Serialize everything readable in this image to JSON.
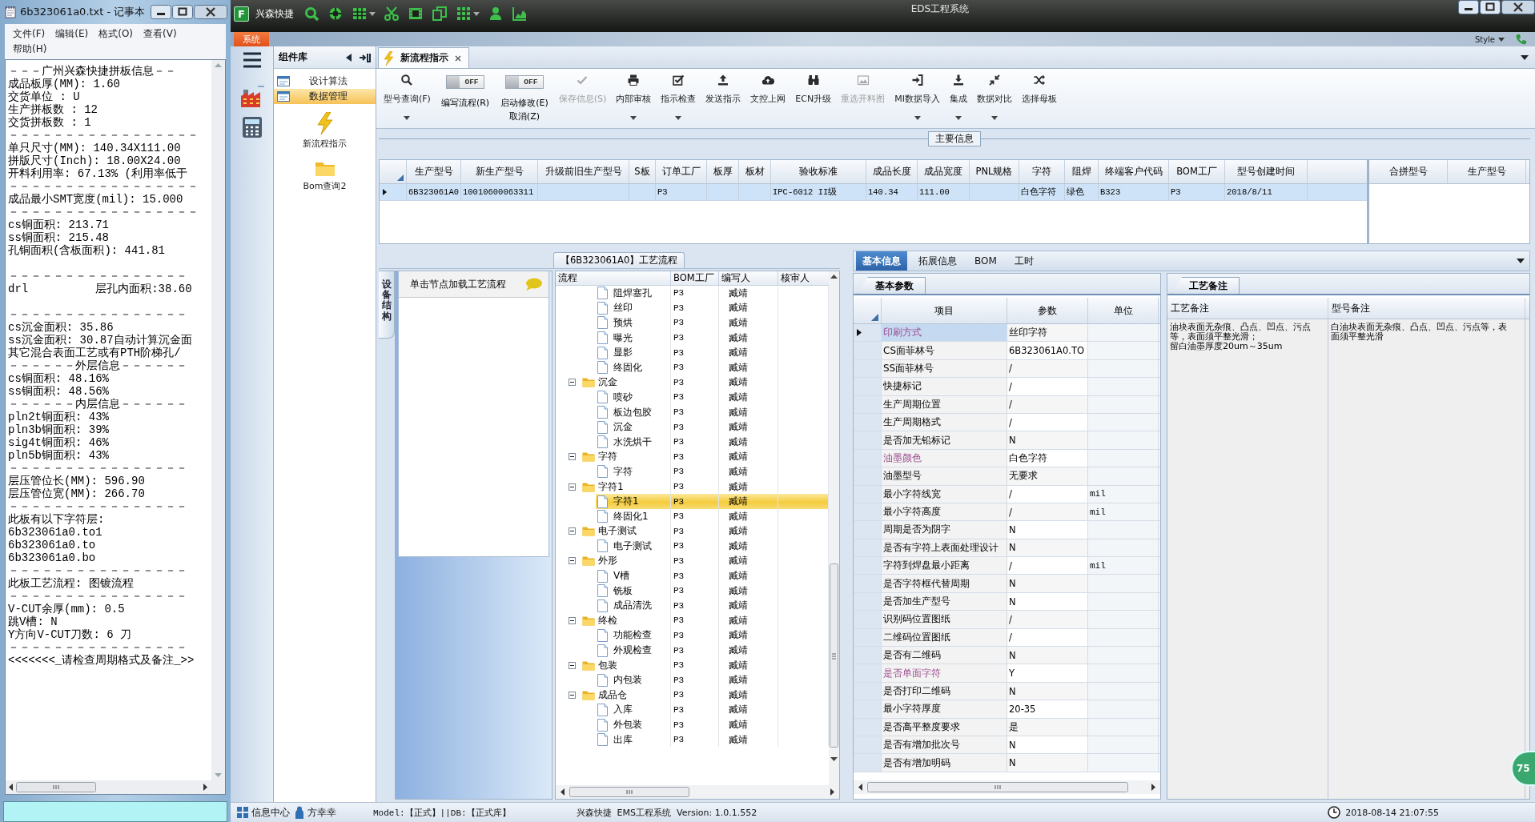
{
  "notepad": {
    "title": "6b323061a0.txt - 记事本",
    "menu": [
      "文件(F)",
      "编辑(E)",
      "格式(O)",
      "查看(V)",
      "帮助(H)"
    ],
    "blocks": [
      [
        "－－－广州兴森快捷拼板信息－－",
        "成品板厚(MM): 1.60",
        "交货单位 : U",
        "生产拼板数 : 12",
        "交货拼板数 : 1",
        "－－－－－－－－－－－－－－－－－",
        "单只尺寸(MM): 140.34X111.00",
        "拼版尺寸(Inch): 18.00X24.00",
        "开料利用率: 67.13% (利用率低于",
        "－－－－－－－－－－－－－－－－－",
        "成品最小SMT宽度(mil): 15.000",
        "－－－－－－－－－－－－－－－－－",
        "cs铜面积: 213.71",
        "ss铜面积: 215.48",
        "孔铜面积(含板面积): 441.81"
      ],
      [
        "－－－－－－－－－－－－－－－－",
        "drl          层孔内面积:38.60"
      ],
      [
        "－－－－－－－－－－－－－－－－",
        "cs沉金面积: 35.86",
        "ss沉金面积: 30.87自动计算沉金面",
        "其它混合表面工艺或有PTH阶梯孔/",
        "－－－－－－外层信息－－－－－－",
        "cs铜面积: 48.16%",
        "ss铜面积: 48.56%",
        "－－－－－－内层信息－－－－－－",
        "pln2t铜面积: 43%",
        "pln3b铜面积: 39%",
        "sig4t铜面积: 46%",
        "pln5b铜面积: 43%",
        "－－－－－－－－－－－－－－－－",
        "层压管位长(MM): 596.90",
        "层压管位宽(MM): 266.70",
        "－－－－－－－－－－－－－－－－",
        "此板有以下字符层:",
        "6b323061a0.to1",
        "6b323061a0.to",
        "6b323061a0.bo",
        "－－－－－－－－－－－－－－－－",
        "此板工艺流程: 图镀流程",
        "－－－－－－－－－－－－－－－－",
        "V-CUT余厚(mm): 0.5",
        "跳V槽: N",
        "Y方向V-CUT刀数: 6 刀",
        "－－－－－－－－－－－－－－－－",
        "<<<<<<<_请检查周期格式及备注_>>"
      ]
    ]
  },
  "app": {
    "logo": "F",
    "brand": "兴森快捷",
    "title": "EDS工程系统",
    "system_tab": "系统",
    "style_menu": "Style"
  },
  "sidebar": {
    "title": "组件库",
    "groups": [
      {
        "label": "设计算法",
        "selected": false
      },
      {
        "label": "数据管理",
        "selected": true
      }
    ],
    "tools": [
      {
        "label": "新流程指示",
        "kind": "lightning"
      },
      {
        "label": "Bom查询2",
        "kind": "folder"
      }
    ]
  },
  "document_tab": {
    "label": "新流程指示"
  },
  "toolbar": [
    {
      "kind": "button",
      "label": "型号查询(F)",
      "menu": true,
      "disabled": false
    },
    {
      "kind": "toggle",
      "label": "编写流程(R)",
      "state": "OFF",
      "on": false
    },
    {
      "kind": "toggle",
      "label": "启动修改(E)",
      "note": "取消(Z)",
      "state": "OFF",
      "on": false
    },
    {
      "kind": "button",
      "label": "保存信息(S)",
      "menu": false,
      "disabled": true
    },
    {
      "kind": "button",
      "label": "内部审核",
      "menu": true,
      "disabled": false
    },
    {
      "kind": "button",
      "label": "指示检查",
      "menu": true,
      "disabled": false
    },
    {
      "kind": "button",
      "label": "发送指示",
      "menu": false,
      "disabled": false
    },
    {
      "kind": "button",
      "label": "文控上网",
      "menu": false,
      "disabled": false
    },
    {
      "kind": "button",
      "label": "ECN升级",
      "menu": false,
      "disabled": false
    },
    {
      "kind": "button",
      "label": "重选开料图",
      "menu": false,
      "disabled": true
    },
    {
      "kind": "button",
      "label": "MI数据导入",
      "menu": true,
      "disabled": false
    },
    {
      "kind": "button",
      "label": "集成",
      "menu": true,
      "disabled": false
    },
    {
      "kind": "button",
      "label": "数据对比",
      "menu": true,
      "disabled": false
    },
    {
      "kind": "button",
      "label": "选择母板",
      "menu": false,
      "disabled": false
    }
  ],
  "main_info": {
    "title": "主要信息",
    "columns": [
      "生产型号",
      "新生产型号",
      "升级前旧生产型号",
      "S板",
      "订单工厂",
      "板厚",
      "板材",
      "验收标准",
      "成品长度",
      "成品宽度",
      "PNL规格",
      "字符",
      "阻焊",
      "终端客户代码",
      "BOM工厂",
      "型号创建时间"
    ],
    "rows": [
      {
        "selected": true,
        "cells": [
          "6B323061A0",
          "10010600063311",
          null,
          null,
          "P3",
          null,
          null,
          "IPC-6012 II级",
          "140.34",
          "111.00",
          null,
          "白色字符",
          "绿色",
          "B323",
          "P3",
          "2018/8/11"
        ]
      }
    ],
    "side_columns": [
      "合拼型号",
      "生产型号"
    ]
  },
  "flow": {
    "title": "【6B323061A0】工艺流程",
    "side_tab": "设备结构",
    "hint": "单击节点加载工艺流程",
    "columns": [
      "流程",
      "BOM工厂",
      "编写人",
      "核审人"
    ],
    "tree": [
      {
        "children": [
          {
            "label": "阻焊塞孔",
            "factory": "P3",
            "author": "臧靖",
            "selected": false
          },
          {
            "label": "丝印",
            "factory": "P3",
            "author": "臧靖",
            "selected": false
          },
          {
            "label": "预烘",
            "factory": "P3",
            "author": "臧靖",
            "selected": false
          },
          {
            "label": "曝光",
            "factory": "P3",
            "author": "臧靖",
            "selected": false
          },
          {
            "label": "显影",
            "factory": "P3",
            "author": "臧靖",
            "selected": false
          },
          {
            "label": "终固化",
            "factory": "P3",
            "author": "臧靖",
            "selected": false
          }
        ]
      },
      {
        "label": "沉金",
        "factory": "P3",
        "author": "臧靖",
        "selected": false,
        "expanded": true,
        "children": [
          {
            "label": "喷砂",
            "factory": "P3",
            "author": "臧靖",
            "selected": false
          },
          {
            "label": "板边包胶",
            "factory": "P3",
            "author": "臧靖",
            "selected": false
          },
          {
            "label": "沉金",
            "factory": "P3",
            "author": "臧靖",
            "selected": false
          },
          {
            "label": "水洗烘干",
            "factory": "P3",
            "author": "臧靖",
            "selected": false
          }
        ]
      },
      {
        "label": "字符",
        "factory": "P3",
        "author": "臧靖",
        "selected": false,
        "expanded": true,
        "children": [
          {
            "label": "字符",
            "factory": "P3",
            "author": "臧靖",
            "selected": false
          }
        ]
      },
      {
        "label": "字符1",
        "factory": "P3",
        "author": "臧靖",
        "selected": false,
        "expanded": true,
        "children": [
          {
            "label": "字符1",
            "factory": "P3",
            "author": "臧靖",
            "selected": true
          },
          {
            "label": "终固化1",
            "factory": "P3",
            "author": "臧靖",
            "selected": false
          }
        ]
      },
      {
        "label": "电子测试",
        "factory": "P3",
        "author": "臧靖",
        "selected": false,
        "expanded": true,
        "children": [
          {
            "label": "电子测试",
            "factory": "P3",
            "author": "臧靖",
            "selected": false
          }
        ]
      },
      {
        "label": "外形",
        "factory": "P3",
        "author": "臧靖",
        "selected": false,
        "expanded": true,
        "children": [
          {
            "label": "V槽",
            "factory": "P3",
            "author": "臧靖",
            "selected": false
          },
          {
            "label": "铣板",
            "factory": "P3",
            "author": "臧靖",
            "selected": false
          },
          {
            "label": "成品清洗",
            "factory": "P3",
            "author": "臧靖",
            "selected": false
          }
        ]
      },
      {
        "label": "终检",
        "factory": "P3",
        "author": "臧靖",
        "selected": false,
        "expanded": true,
        "children": [
          {
            "label": "功能检查",
            "factory": "P3",
            "author": "臧靖",
            "selected": false
          },
          {
            "label": "外观检查",
            "factory": "P3",
            "author": "臧靖",
            "selected": false
          }
        ]
      },
      {
        "label": "包装",
        "factory": "P3",
        "author": "臧靖",
        "selected": false,
        "expanded": true,
        "children": [
          {
            "label": "内包装",
            "factory": "P3",
            "author": "臧靖",
            "selected": false
          }
        ]
      },
      {
        "label": "成品仓",
        "factory": "P3",
        "author": "臧靖",
        "selected": false,
        "expanded": true,
        "children": [
          {
            "label": "入库",
            "factory": "P3",
            "author": "臧靖",
            "selected": false
          },
          {
            "label": "外包装",
            "factory": "P3",
            "author": "臧靖",
            "selected": false
          },
          {
            "label": "出库",
            "factory": "P3",
            "author": "臧靖",
            "selected": false
          }
        ]
      }
    ]
  },
  "detail": {
    "tabs": [
      {
        "label": "基本信息",
        "selected": true
      },
      {
        "label": "拓展信息",
        "selected": false
      },
      {
        "label": "BOM",
        "selected": false
      },
      {
        "label": "工时",
        "selected": false
      }
    ],
    "params": {
      "title": "基本参数",
      "columns": [
        "项目",
        "参数",
        "单位"
      ],
      "rows": [
        {
          "item": "印刷方式",
          "value": "丝印字符",
          "selected": true,
          "highlight": true
        },
        {
          "item": "CS面菲林号",
          "value": "6B323061A0.TO",
          "selected": false,
          "highlight": false
        },
        {
          "item": "SS面菲林号",
          "value": "/",
          "selected": false,
          "highlight": false
        },
        {
          "item": "快捷标记",
          "value": "/",
          "selected": false,
          "highlight": false
        },
        {
          "item": "生产周期位置",
          "value": "/",
          "selected": false,
          "highlight": false
        },
        {
          "item": "生产周期格式",
          "value": "/",
          "selected": false,
          "highlight": false
        },
        {
          "item": "是否加无铅标记",
          "value": "N",
          "selected": false,
          "highlight": false
        },
        {
          "item": "油墨颜色",
          "value": "白色字符",
          "selected": false,
          "highlight": true
        },
        {
          "item": "油墨型号",
          "value": "无要求",
          "selected": false,
          "highlight": false
        },
        {
          "item": "最小字符线宽",
          "value": "/",
          "unit": "mil",
          "selected": false,
          "highlight": false
        },
        {
          "item": "最小字符高度",
          "value": "/",
          "unit": "mil",
          "selected": false,
          "highlight": false
        },
        {
          "item": "周期是否为阴字",
          "value": "N",
          "selected": false,
          "highlight": false
        },
        {
          "item": "是否有字符上表面处理设计",
          "value": "N",
          "selected": false,
          "highlight": false
        },
        {
          "item": "字符到焊盘最小距离",
          "value": "/",
          "unit": "mil",
          "selected": false,
          "highlight": false
        },
        {
          "item": "是否字符框代替周期",
          "value": "N",
          "selected": false,
          "highlight": false
        },
        {
          "item": "是否加生产型号",
          "value": "N",
          "selected": false,
          "highlight": false
        },
        {
          "item": "识别码位置图纸",
          "value": "/",
          "selected": false,
          "highlight": false
        },
        {
          "item": "二维码位置图纸",
          "value": "/",
          "selected": false,
          "highlight": false
        },
        {
          "item": "是否有二维码",
          "value": "N",
          "selected": false,
          "highlight": false
        },
        {
          "item": "是否单面字符",
          "value": "Y",
          "selected": false,
          "highlight": true
        },
        {
          "item": "是否打印二维码",
          "value": "N",
          "selected": false,
          "highlight": false
        },
        {
          "item": "最小字符厚度",
          "value": "20-35",
          "selected": false,
          "highlight": false
        },
        {
          "item": "是否高平整度要求",
          "value": "是",
          "selected": false,
          "highlight": false
        },
        {
          "item": "是否有增加批次号",
          "value": "N",
          "selected": false,
          "highlight": false
        },
        {
          "item": "是否有增加明码",
          "value": "N",
          "selected": false,
          "highlight": false
        }
      ]
    },
    "notes": {
      "title": "工艺备注",
      "columns": [
        "工艺备注",
        "型号备注"
      ],
      "texts": [
        [
          "油块表面无杂痕、凸点、凹点、污点等，表面须平整光滑；",
          "留白油墨厚度20um～35um"
        ],
        [
          "白油块表面无杂痕、凸点、凹点、污点等，表面须平整光滑"
        ]
      ]
    }
  },
  "status": {
    "info_center": "信息中心",
    "user": "方幸幸",
    "model": "Model:【正式】||DB:【正式库】",
    "version": "兴森快捷  EMS工程系统  Version: 1.0.1.552",
    "clock": "2018-08-14 21:07:55"
  },
  "badge": "75"
}
